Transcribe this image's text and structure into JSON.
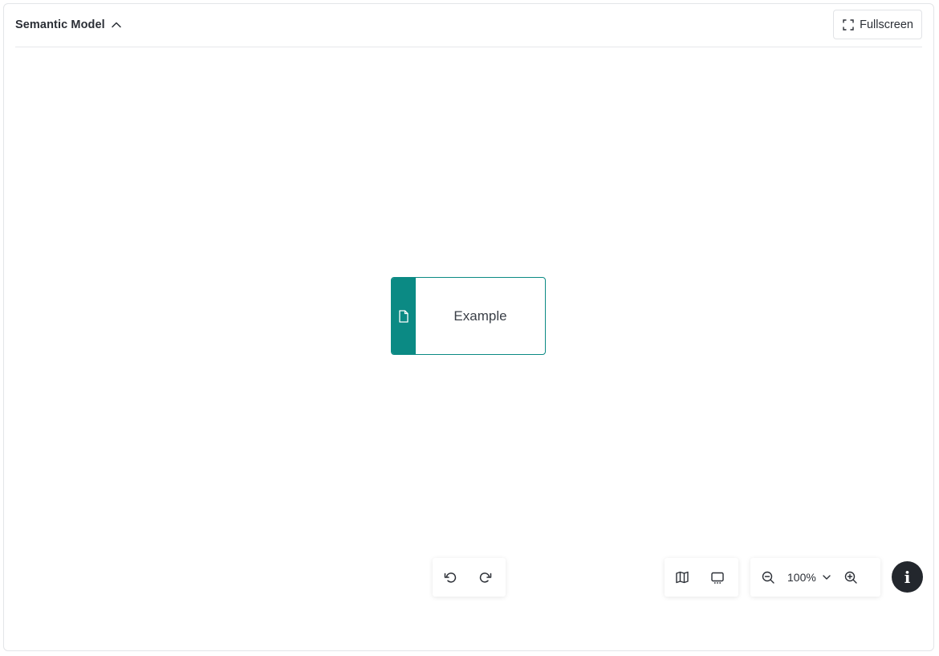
{
  "header": {
    "title": "Semantic Model",
    "fullscreen_label": "Fullscreen"
  },
  "canvas": {
    "node": {
      "label": "Example",
      "icon": "file-icon",
      "color": "#0b8a84"
    }
  },
  "toolbar": {
    "undo_icon": "undo-icon",
    "redo_icon": "redo-icon",
    "minimap_icon": "map-icon",
    "fit_icon": "fit-view-icon",
    "zoom_out_icon": "zoom-out-icon",
    "zoom_in_icon": "zoom-in-icon",
    "zoom_level": "100%"
  },
  "info": {
    "glyph": "i",
    "color": "#23272d"
  }
}
